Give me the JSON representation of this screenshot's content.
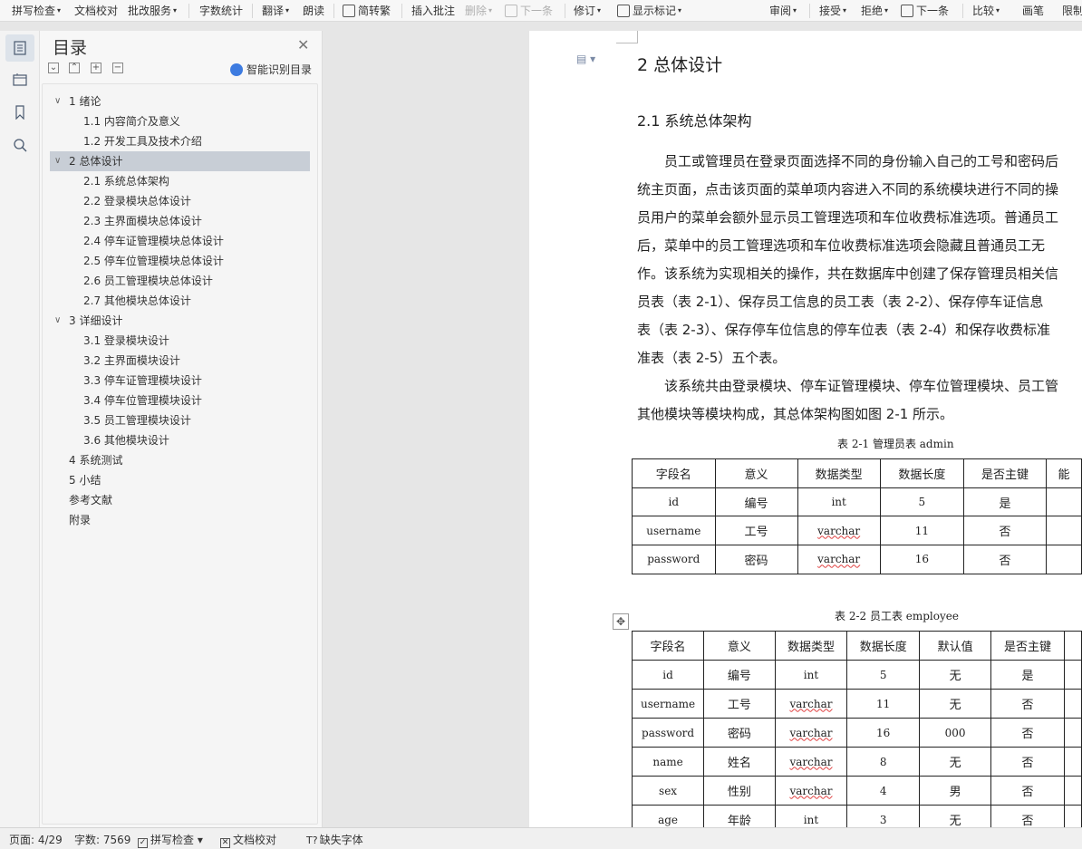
{
  "toolbar": {
    "items": [
      {
        "label": "拼写检查",
        "caret": true,
        "disabled": false
      },
      {
        "label": "文档校对",
        "caret": false,
        "disabled": false
      },
      {
        "label": "批改服务",
        "caret": true,
        "disabled": false
      },
      {
        "label": "字数统计",
        "caret": false,
        "disabled": false
      },
      {
        "label": "翻译",
        "caret": true,
        "disabled": false
      },
      {
        "label": "朗读",
        "caret": false,
        "disabled": false
      },
      {
        "label": "简转繁",
        "caret": false,
        "disabled": false
      },
      {
        "label": "插入批注",
        "caret": false,
        "disabled": false
      },
      {
        "label": "删除",
        "caret": true,
        "disabled": true
      },
      {
        "label": "下一条",
        "caret": false,
        "disabled": true
      },
      {
        "label": "修订",
        "caret": true,
        "disabled": false
      },
      {
        "label": "显示标记",
        "caret": true,
        "disabled": false
      },
      {
        "label": "审阅",
        "caret": true,
        "disabled": false
      },
      {
        "label": "接受",
        "caret": true,
        "disabled": false
      },
      {
        "label": "拒绝",
        "caret": true,
        "disabled": false
      },
      {
        "label": "下一条",
        "caret": false,
        "disabled": false
      },
      {
        "label": "比较",
        "caret": true,
        "disabled": false
      },
      {
        "label": "画笔",
        "caret": false,
        "disabled": false
      },
      {
        "label": "限制",
        "caret": false,
        "disabled": false
      }
    ]
  },
  "toc": {
    "title": "目录",
    "smart_label": "智能识别目录",
    "items": [
      {
        "label": "1 绪论",
        "level": 1,
        "expanded": true,
        "selected": false
      },
      {
        "label": "1.1 内容简介及意义",
        "level": 2,
        "selected": false
      },
      {
        "label": "1.2 开发工具及技术介绍",
        "level": 2,
        "selected": false
      },
      {
        "label": "2 总体设计",
        "level": 1,
        "expanded": true,
        "selected": true
      },
      {
        "label": "2.1 系统总体架构",
        "level": 2,
        "selected": false
      },
      {
        "label": "2.2 登录模块总体设计",
        "level": 2,
        "selected": false
      },
      {
        "label": "2.3 主界面模块总体设计",
        "level": 2,
        "selected": false
      },
      {
        "label": "2.4 停车证管理模块总体设计",
        "level": 2,
        "selected": false
      },
      {
        "label": "2.5 停车位管理模块总体设计",
        "level": 2,
        "selected": false
      },
      {
        "label": "2.6 员工管理模块总体设计",
        "level": 2,
        "selected": false
      },
      {
        "label": "2.7 其他模块总体设计",
        "level": 2,
        "selected": false
      },
      {
        "label": "3 详细设计",
        "level": 1,
        "expanded": true,
        "selected": false
      },
      {
        "label": "3.1 登录模块设计",
        "level": 2,
        "selected": false
      },
      {
        "label": "3.2 主界面模块设计",
        "level": 2,
        "selected": false
      },
      {
        "label": "3.3 停车证管理模块设计",
        "level": 2,
        "selected": false
      },
      {
        "label": "3.4 停车位管理模块设计",
        "level": 2,
        "selected": false
      },
      {
        "label": "3.5 员工管理模块设计",
        "level": 2,
        "selected": false
      },
      {
        "label": "3.6 其他模块设计",
        "level": 2,
        "selected": false
      },
      {
        "label": "4 系统测试",
        "level": 1,
        "selected": false
      },
      {
        "label": "5 小结",
        "level": 1,
        "selected": false
      },
      {
        "label": "参考文献",
        "level": 1,
        "selected": false
      },
      {
        "label": "附录",
        "level": 1,
        "selected": false
      }
    ]
  },
  "document": {
    "heading1": "2 总体设计",
    "heading2": "2.1 系统总体架构",
    "paragraph_lines": [
      "　　员工或管理员在登录页面选择不同的身份输入自己的工号和密码后",
      "统主页面，点击该页面的菜单项内容进入不同的系统模块进行不同的操",
      "员用户的菜单会额外显示员工管理选项和车位收费标准选项。普通员工",
      "后，菜单中的员工管理选项和车位收费标准选项会隐藏且普通员工无",
      "作。该系统为实现相关的操作，共在数据库中创建了保存管理员相关信",
      "员表（表 2-1）、保存员工信息的员工表（表 2-2）、保存停车证信息",
      "表（表 2-3）、保存停车位信息的停车位表（表 2-4）和保存收费标准",
      "准表（表 2-5）五个表。",
      "　　该系统共由登录模块、停车证管理模块、停车位管理模块、员工管",
      "其他模块等模块构成，其总体架构图如图 2-1 所示。"
    ],
    "table1": {
      "caption": "表 2-1 管理员表 admin",
      "headers": [
        "字段名",
        "意义",
        "数据类型",
        "数据长度",
        "是否主键",
        "能"
      ],
      "rows": [
        [
          "id",
          "编号",
          "int",
          "5",
          "是",
          ""
        ],
        [
          "username",
          "工号",
          "varchar",
          "11",
          "否",
          ""
        ],
        [
          "password",
          "密码",
          "varchar",
          "16",
          "否",
          ""
        ]
      ]
    },
    "table2": {
      "caption": "表 2-2 员工表 employee",
      "headers": [
        "字段名",
        "意义",
        "数据类型",
        "数据长度",
        "默认值",
        "是否主键",
        ""
      ],
      "rows": [
        [
          "id",
          "编号",
          "int",
          "5",
          "无",
          "是",
          ""
        ],
        [
          "username",
          "工号",
          "varchar",
          "11",
          "无",
          "否",
          ""
        ],
        [
          "password",
          "密码",
          "varchar",
          "16",
          "000",
          "否",
          ""
        ],
        [
          "name",
          "姓名",
          "varchar",
          "8",
          "无",
          "否",
          ""
        ],
        [
          "sex",
          "性别",
          "varchar",
          "4",
          "男",
          "否",
          ""
        ],
        [
          "age",
          "年龄",
          "int",
          "3",
          "无",
          "否",
          ""
        ]
      ]
    }
  },
  "status": {
    "page": "页面: 4/29",
    "words": "字数: 7569",
    "spell": "拼写检查",
    "proof": "文档校对",
    "missing_font": "缺失字体"
  },
  "colors": {
    "selected_toc": "#c8ced6",
    "accent": "#3d7be0",
    "squiggle": "#e04040"
  }
}
